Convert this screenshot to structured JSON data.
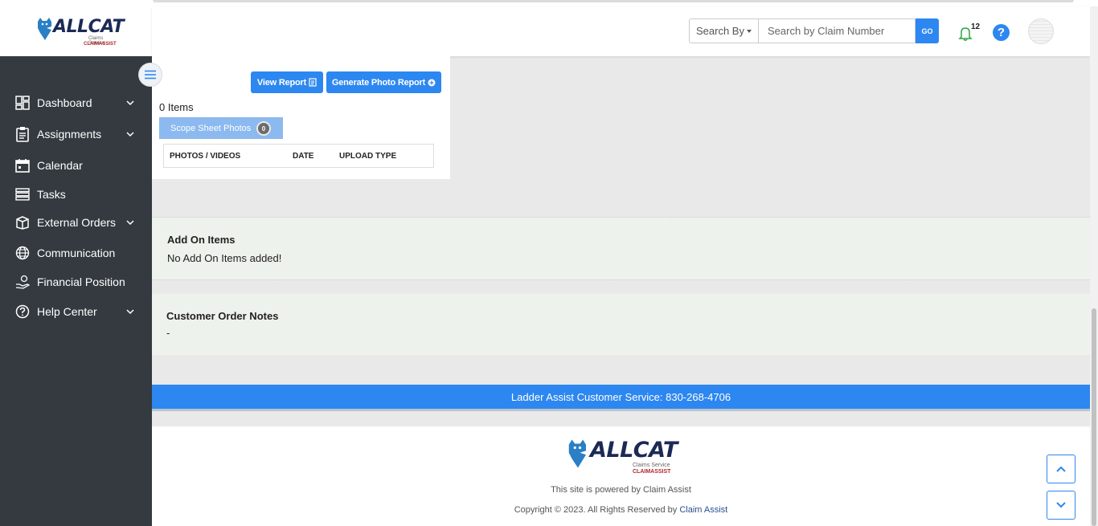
{
  "brand": {
    "name": "ALLCAT",
    "tagline": "Claims Service",
    "byline": "CLAIMASSIST"
  },
  "sidebar": {
    "items": [
      {
        "label": "Dashboard",
        "icon": "dashboard-icon",
        "has_submenu": true
      },
      {
        "label": "Assignments",
        "icon": "clipboard-icon",
        "has_submenu": true
      },
      {
        "label": "Calendar",
        "icon": "calendar-icon",
        "has_submenu": false
      },
      {
        "label": "Tasks",
        "icon": "tasks-icon",
        "has_submenu": false
      },
      {
        "label": "External Orders",
        "icon": "box-icon",
        "has_submenu": true
      },
      {
        "label": "Communication",
        "icon": "globe-icon",
        "has_submenu": false
      },
      {
        "label": "Financial Position",
        "icon": "hand-money-icon",
        "has_submenu": false
      },
      {
        "label": "Help Center",
        "icon": "question-circle-icon",
        "has_submenu": true
      }
    ]
  },
  "header": {
    "search_by_label": "Search By",
    "search_placeholder": "Search by Claim Number",
    "go_label": "GO",
    "notification_count": "12",
    "help_label": "?"
  },
  "photos": {
    "view_report_label": "View Report",
    "generate_report_label": "Generate Photo Report",
    "items_count": "0 Items",
    "tab_label": "Scope Sheet Photos",
    "tab_count": "0",
    "columns": [
      "PHOTOS / VIDEOS",
      "DATE",
      "UPLOAD TYPE"
    ]
  },
  "add_on": {
    "title": "Add On Items",
    "text": "No Add On Items added!"
  },
  "notes": {
    "title": "Customer Order Notes",
    "text": "-"
  },
  "customer_service": "Ladder Assist Customer Service: 830-268-4706",
  "footer": {
    "powered": "This site is powered by Claim Assist",
    "copyright_prefix": "Copyright © 2023. All Rights Reserved by ",
    "copyright_link": "Claim Assist"
  },
  "colors": {
    "primary": "#2d87f0",
    "sidebar": "#343a40",
    "section_bg": "#eef2ec"
  }
}
